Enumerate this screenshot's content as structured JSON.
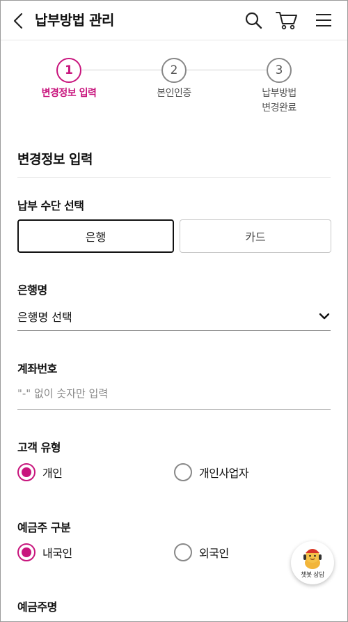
{
  "header": {
    "title": "납부방법 관리"
  },
  "steps": [
    {
      "number": "1",
      "label": "변경정보 입력",
      "active": true
    },
    {
      "number": "2",
      "label": "본인인증",
      "active": false
    },
    {
      "number": "3",
      "label_line1": "납부방법",
      "label_line2": "변경완료",
      "active": false
    }
  ],
  "section_title": "변경정보 입력",
  "payment_method": {
    "label": "납부 수단 선택",
    "options": [
      "은행",
      "카드"
    ],
    "selected": "은행"
  },
  "bank": {
    "label": "은행명",
    "value": "은행명 선택"
  },
  "account": {
    "label": "계좌번호",
    "placeholder": "\"-\" 없이 숫자만 입력"
  },
  "customer_type": {
    "label": "고객 유형",
    "options": [
      "개인",
      "개인사업자"
    ],
    "selected": "개인"
  },
  "depositor_type": {
    "label": "예금주 구분",
    "options": [
      "내국인",
      "외국인"
    ],
    "selected": "내국인"
  },
  "depositor_name": {
    "label": "예금주명"
  },
  "chatbot": {
    "label": "챗봇 상담"
  },
  "colors": {
    "accent": "#c8157d",
    "text": "#111111",
    "muted": "#555555"
  }
}
